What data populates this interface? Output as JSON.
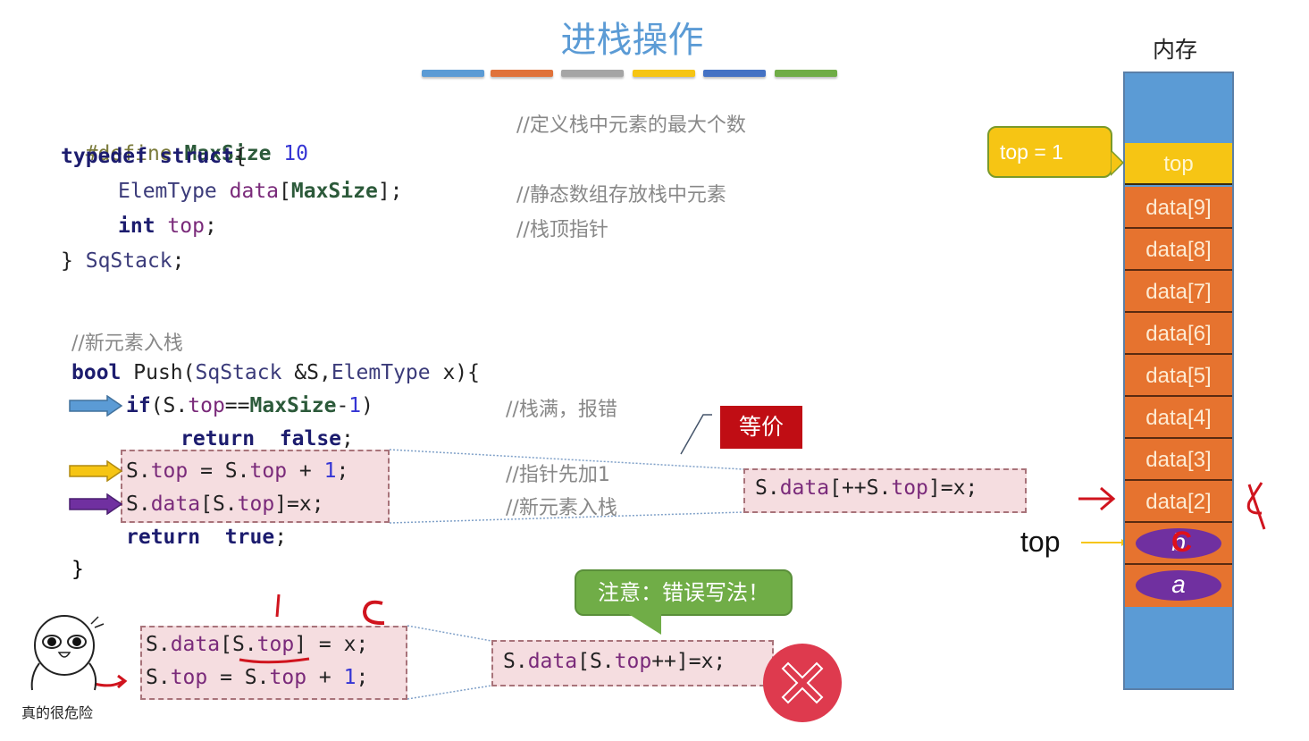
{
  "slide": {
    "title": "进栈操作",
    "title_bar_colors": [
      "#5b9bd5",
      "#e0723a",
      "#a5a5a5",
      "#f6c514",
      "#4472c4",
      "#70ad47"
    ]
  },
  "struct_code": {
    "line1": {
      "pp": "#define",
      "macro": "MaxSize",
      "num": "10"
    },
    "line2": {
      "kw1": "typedef",
      "kw2": "struct",
      "tail": "{"
    },
    "line3": {
      "type": "ElemType",
      "var": "data",
      "open": "[",
      "macro": "MaxSize",
      "close": "];"
    },
    "line4": {
      "kw": "int",
      "var": "top",
      "tail": ";"
    },
    "line5": {
      "brace": "}",
      "type": "SqStack",
      "tail": ";"
    },
    "comments": [
      "//定义栈中元素的最大个数",
      "//静态数组存放栈中元素",
      "//栈顶指针"
    ]
  },
  "push_code": {
    "comment_header": "//新元素入栈",
    "signature": {
      "kw": "bool",
      "name": "Push(",
      "type1": "SqStack",
      "param1": " &S,",
      "type2": "ElemType",
      "param2": " x){"
    },
    "if_line": {
      "kw": "if",
      "open": "(S.",
      "var": "top",
      "op": "==",
      "macro": "MaxSize",
      "minus": "-",
      "num": "1",
      "close": ")"
    },
    "return_false": {
      "kw1": "return",
      "kw2": "false",
      "tail": ";"
    },
    "inc_line": {
      "s1": "S.",
      "v1": "top",
      "mid": " = S.",
      "v2": "top",
      "plus": " + ",
      "num": "1",
      "tail": ";"
    },
    "assign_line": {
      "s1": "S.",
      "v1": "data",
      "mid": "[S.",
      "v2": "top",
      "tail": "]=x;"
    },
    "return_true": {
      "kw1": "return",
      "kw2": "true",
      "tail": ";"
    },
    "close_brace": "}",
    "comments": [
      "//栈满，报错",
      "//指针先加1",
      "//新元素入栈"
    ]
  },
  "equivalent": {
    "badge": "等价",
    "code": {
      "s1": "S.",
      "v1": "data",
      "mid": "[++S.",
      "v2": "top",
      "tail": "]=x;"
    }
  },
  "wrong": {
    "bubble": "注意：错误写法！",
    "code": {
      "s1": "S.",
      "v1": "data",
      "mid": "[S.",
      "v2": "top",
      "tail": "++]=x;"
    },
    "expanded_line1": {
      "s1": "S.",
      "v1": "data",
      "mid": "[S.",
      "v2": "top",
      "tail": "] = x;"
    },
    "expanded_line2": {
      "s1": "S.",
      "v1": "top",
      "mid": " = S.",
      "v2": "top",
      "plus": " + ",
      "num": "1",
      "tail": ";"
    },
    "handwriting": [
      "1",
      "C"
    ],
    "meme_caption": "真的很危险"
  },
  "memory": {
    "label": "内存",
    "top_bubble": "top = 1",
    "top_cell": "top",
    "cells": [
      "data[9]",
      "data[8]",
      "data[7]",
      "data[6]",
      "data[5]",
      "data[4]",
      "data[3]",
      "data[2]"
    ],
    "filled": [
      "b",
      "a"
    ],
    "handwritten_overwrite": "C",
    "top_pointer_label": "top"
  }
}
